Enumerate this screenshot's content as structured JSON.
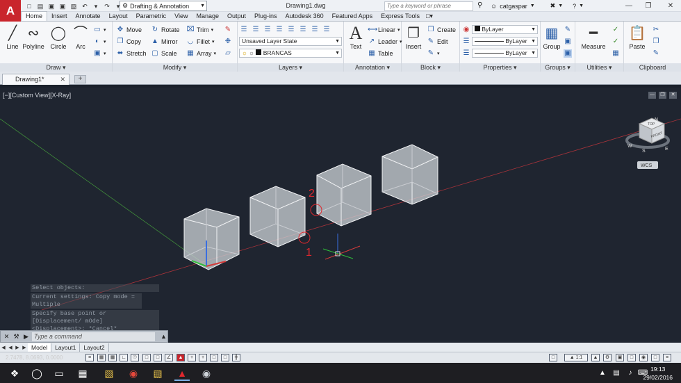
{
  "titlebar": {
    "app_logo": "A",
    "workspace": "Drafting & Annotation",
    "doc_title": "Drawing1.dwg",
    "search_placeholder": "Type a keyword or phrase",
    "user": "catgaspar"
  },
  "tabs": [
    "Home",
    "Insert",
    "Annotate",
    "Layout",
    "Parametric",
    "View",
    "Manage",
    "Output",
    "Plug-ins",
    "Autodesk 360",
    "Featured Apps",
    "Express Tools"
  ],
  "ribbon": {
    "draw": {
      "label": "Draw",
      "tools": [
        "Line",
        "Polyline",
        "Circle",
        "Arc"
      ]
    },
    "modify": {
      "label": "Modify",
      "row1": [
        "Move",
        "Rotate",
        "Trim"
      ],
      "row2": [
        "Copy",
        "Mirror",
        "Fillet"
      ],
      "row3": [
        "Stretch",
        "Scale",
        "Array"
      ]
    },
    "layers": {
      "label": "Layers",
      "layer_state": "Unsaved Layer State",
      "current_layer": "BRANCAS"
    },
    "annotation": {
      "label": "Annotation",
      "text": "Text",
      "items": [
        "Linear",
        "Leader",
        "Table"
      ]
    },
    "block": {
      "label": "Block",
      "insert": "Insert",
      "items": [
        "Create",
        "Edit"
      ]
    },
    "properties": {
      "label": "Properties",
      "color": "ByLayer",
      "linetype": "ByLayer",
      "lineweight": "ByLayer"
    },
    "groups": {
      "label": "Groups",
      "group": "Group"
    },
    "utilities": {
      "label": "Utilities",
      "measure": "Measure"
    },
    "clipboard": {
      "label": "Clipboard",
      "paste": "Paste"
    }
  },
  "file_tab": "Drawing1*",
  "viewport": {
    "label": "[−][Custom View][X-Ray]",
    "viewcube_top": "TOP",
    "viewcube_front": "FRONT",
    "compass_n": "N",
    "compass_s": "S",
    "compass_w": "W",
    "compass_e": "E",
    "wcs": "WCS",
    "marker1": "1",
    "marker2": "2"
  },
  "command": {
    "history": [
      "Select objects:",
      "Current settings:  Copy mode = Multiple",
      "Specify base point or [Displacement/ mOde] <Displacement>: *Cancel*"
    ],
    "placeholder": "Type a command"
  },
  "layout_tabs": [
    "Model",
    "Layout1",
    "Layout2"
  ],
  "status": {
    "coords": "2.7478, 8.0693, 0.0000",
    "scale": "1:1"
  },
  "taskbar": {
    "time": "19:13",
    "date": "29/02/2016"
  },
  "colors": {
    "accent": "#c9252c",
    "viewport_bg": "#1f2530",
    "marker": "#e0282e"
  }
}
